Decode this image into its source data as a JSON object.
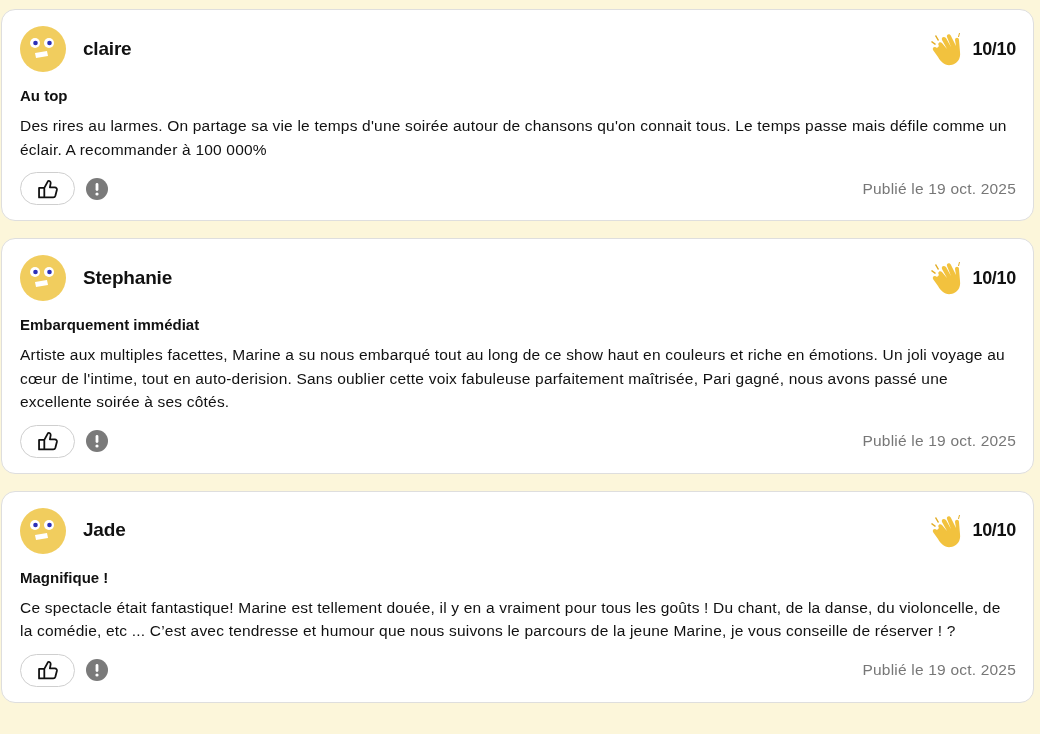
{
  "reviews": [
    {
      "author": "claire",
      "score": "10/10",
      "title": "Au top",
      "body": "Des rires au larmes. On partage sa vie le temps d'une soirée autour de chansons qu'on connait tous. Le temps passe mais défile comme un éclair. A recommander à 100 000%",
      "date": "Publié le 19 oct. 2025"
    },
    {
      "author": "Stephanie",
      "score": "10/10",
      "title": "Embarquement immédiat",
      "body": "Artiste aux multiples facettes, Marine a su nous embarqué tout au long de ce show haut en couleurs et riche en émotions. Un joli voyage au cœur de l'intime, tout en auto-derision. Sans oublier cette voix fabuleuse parfaitement maîtrisée, Pari gagné, nous avons passé une excellente soirée à ses côtés.",
      "date": "Publié le 19 oct. 2025"
    },
    {
      "author": "Jade",
      "score": "10/10",
      "title": "Magnifique !",
      "body": "Ce spectacle était fantastique! Marine est tellement douée, il y en a vraiment pour tous les goûts ! Du chant, de la danse, du violoncelle, de la comédie, etc ... C’est avec tendresse et humour que nous suivons le parcours de la jeune Marine, je vous conseille de réserver ! ?",
      "date": "Publié le 19 oct. 2025"
    }
  ]
}
